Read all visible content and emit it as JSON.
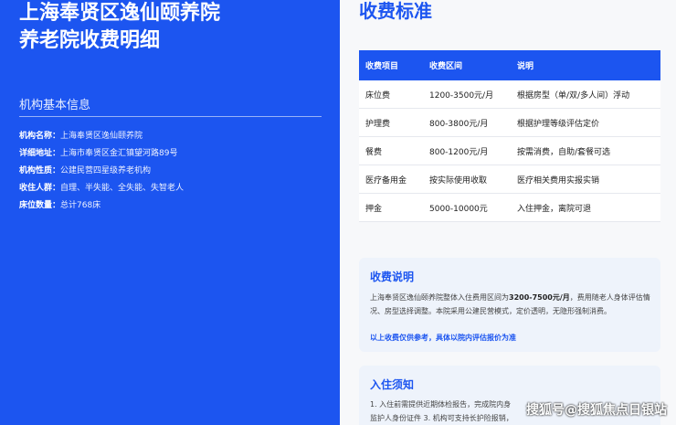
{
  "left": {
    "title_line1": "上海奉贤区逸仙颐养院",
    "title_line2": "养老院收费明细",
    "info_heading": "机构基本信息",
    "info": [
      {
        "label": "机构名称：",
        "value": "上海奉贤区逸仙颐养院"
      },
      {
        "label": "详细地址：",
        "value": "上海市奉贤区金汇镇望河路89号"
      },
      {
        "label": "机构性质：",
        "value": "公建民营四星级养老机构"
      },
      {
        "label": "收住人群：",
        "value": "自理、半失能、全失能、失智老人"
      },
      {
        "label": "床位数量：",
        "value": "总计768床"
      }
    ]
  },
  "right": {
    "title": "收费标准",
    "table": {
      "headers": [
        "收费项目",
        "收费区间",
        "说明"
      ],
      "rows": [
        [
          "床位费",
          "1200-3500元/月",
          "根据房型（单/双/多人间）浮动"
        ],
        [
          "护理费",
          "800-3800元/月",
          "根据护理等级评估定价"
        ],
        [
          "餐费",
          "800-1200元/月",
          "按需消费，自助/套餐可选"
        ],
        [
          "医疗备用金",
          "按实际使用收取",
          "医疗相关费用实报实销"
        ],
        [
          "押金",
          "5000-10000元",
          "入住押金，离院可退"
        ]
      ]
    },
    "desc_card": {
      "title": "收费说明",
      "body_pre": "上海奉贤区逸仙颐养院整体入住费用区间为",
      "body_bold": "3200-7500元/月",
      "body_post": "，费用随老人身体评估情况、房型选择调整。本院采用公建民营模式，定价透明，无隐形强制消费。",
      "note": "以上收费仅供参考，具体以院内评估报价为准"
    },
    "admit_card": {
      "title": "入住须知",
      "line1": "1. 入住前需提供近期体检报告，完成院内身",
      "line2": "监护人身份证件 3. 机构可支持长护险报销，"
    }
  },
  "watermark": "搜狐号@搜狐焦点日银站"
}
